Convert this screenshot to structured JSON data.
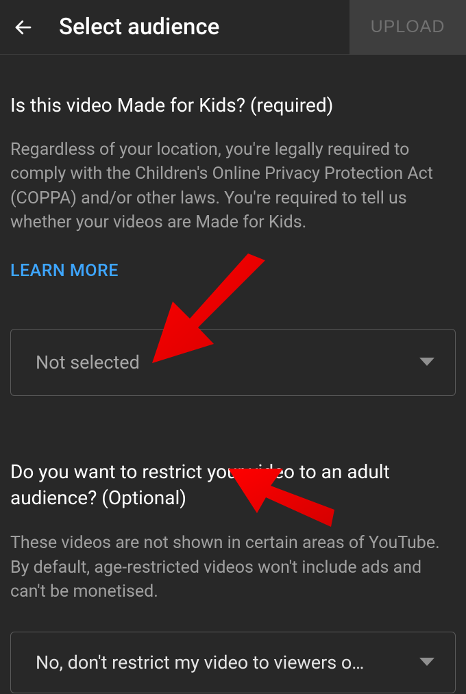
{
  "header": {
    "title": "Select audience",
    "upload_label": "UPLOAD"
  },
  "section1": {
    "heading": "Is this video Made for Kids? (required)",
    "body": "Regardless of your location, you're legally required to comply with the Children's Online Privacy Protection Act (COPPA) and/or other laws. You're required to tell us whether your videos are Made for Kids.",
    "learn_more": "LEARN MORE",
    "dropdown_value": "Not selected"
  },
  "section2": {
    "heading": "Do you want to restrict your video to an adult audience? (Optional)",
    "body": "These videos are not shown in certain areas of YouTube. By default, age-restricted videos won't include ads and can't be monetised.",
    "dropdown_value": "No, don't restrict my video to viewers o…"
  }
}
